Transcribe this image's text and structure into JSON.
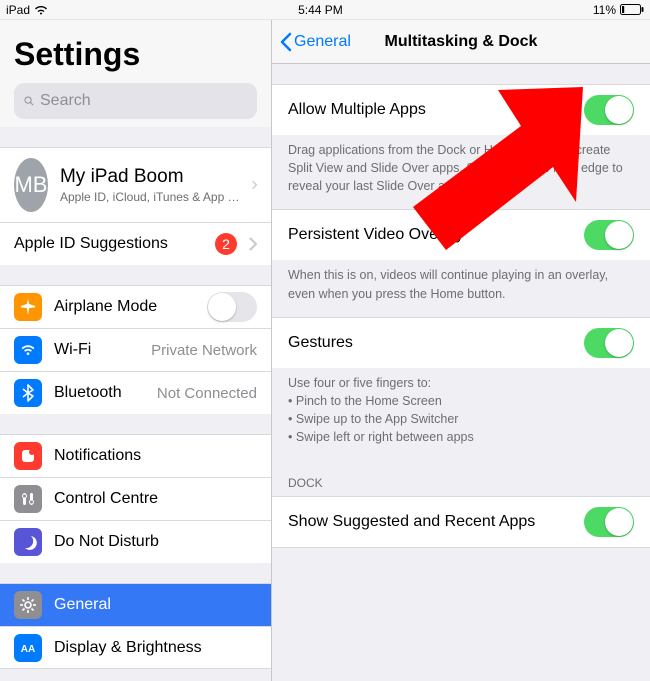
{
  "statusbar": {
    "carrier": "iPad",
    "time": "5:44 PM",
    "battery_pct": "11%"
  },
  "sidebar": {
    "title": "Settings",
    "search_placeholder": "Search",
    "apple_id": {
      "initials": "MB",
      "name": "My iPad Boom",
      "subtitle": "Apple ID, iCloud, iTunes & App St..."
    },
    "suggestions": {
      "label": "Apple ID Suggestions",
      "badge": "2"
    },
    "airplane": {
      "label": "Airplane Mode",
      "on": false
    },
    "wifi": {
      "label": "Wi-Fi",
      "value": "Private Network"
    },
    "bluetooth": {
      "label": "Bluetooth",
      "value": "Not Connected"
    },
    "notifications": {
      "label": "Notifications"
    },
    "control_centre": {
      "label": "Control Centre"
    },
    "dnd": {
      "label": "Do Not Disturb"
    },
    "general": {
      "label": "General"
    },
    "display": {
      "label": "Display & Brightness"
    }
  },
  "detail": {
    "back": "General",
    "title": "Multitasking & Dock",
    "allow_multiple": {
      "label": "Allow Multiple Apps",
      "on": true,
      "help": "Drag applications from the Dock or Home screen to create Split View and Slide Over apps. Swipe from the right edge to reveal your last Slide Over app."
    },
    "pip": {
      "label": "Persistent Video Overlay",
      "on": true,
      "help": "When this is on, videos will continue playing in an overlay, even when you press the Home button."
    },
    "gestures": {
      "label": "Gestures",
      "on": true,
      "help_intro": "Use four or five fingers to:",
      "bullets": [
        "Pinch to the Home Screen",
        "Swipe up to the App Switcher",
        "Swipe left or right between apps"
      ]
    },
    "dock_header": "Dock",
    "show_recent": {
      "label": "Show Suggested and Recent Apps",
      "on": true
    }
  },
  "colors": {
    "accent": "#007aff",
    "green": "#4cd964",
    "red": "#ff3b30"
  }
}
